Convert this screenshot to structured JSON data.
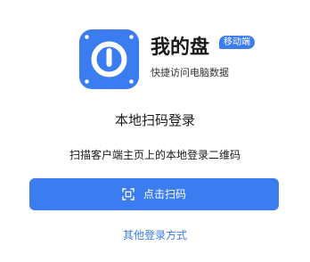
{
  "app": {
    "name": "我的盘",
    "badge": "移动端",
    "slogan": "快捷访问电脑数据"
  },
  "login": {
    "title": "本地扫码登录",
    "hint": "扫描客户端主页上的本地登录二维码",
    "scan_button": {
      "icon": "scan-icon",
      "label": "点击扫码"
    },
    "other_methods": "其他登录方式"
  },
  "colors": {
    "accent": "#3b7cf0",
    "text": "#1a1a1a",
    "background": "#ffffff"
  }
}
